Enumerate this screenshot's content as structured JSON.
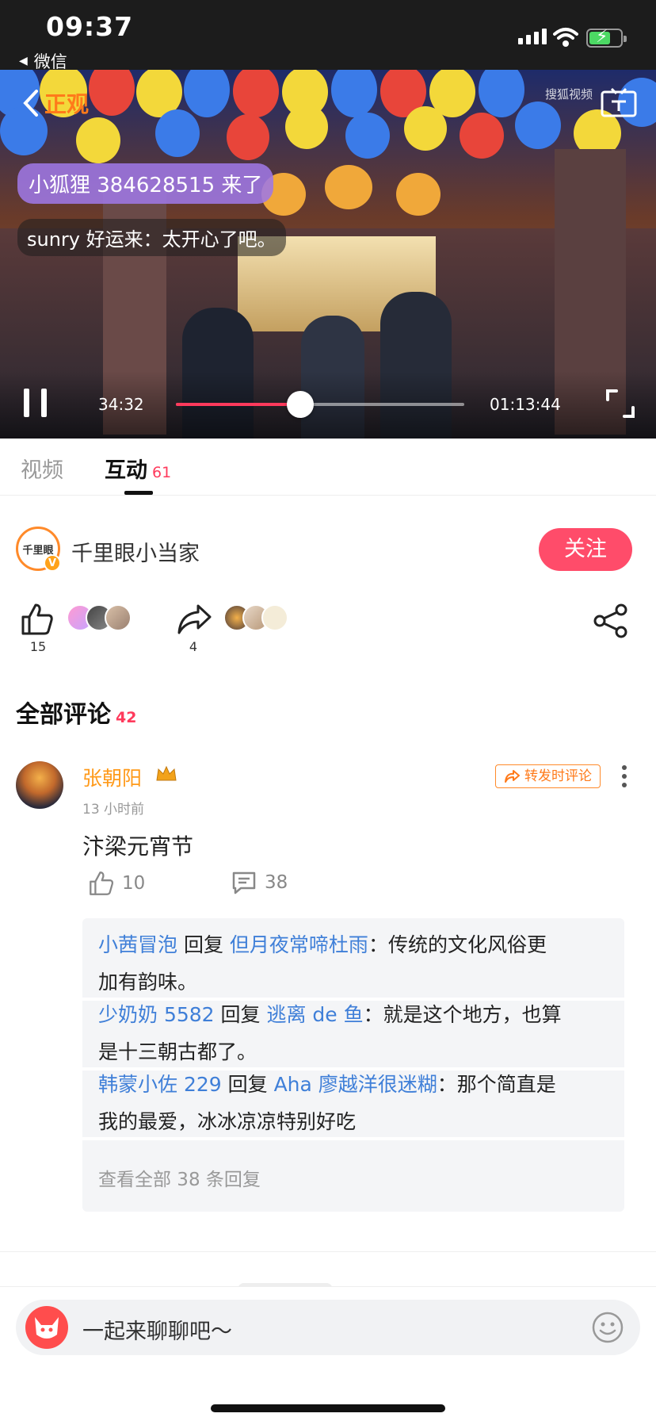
{
  "status_bar": {
    "time": "09:37",
    "back_app": "微信"
  },
  "player": {
    "back_label": "正观",
    "watermark": "搜狐视频",
    "join_notice": "小狐狸 384628515 来了",
    "danmaku": "sunry 好运来：太开心了吧。",
    "current_time": "34:32",
    "total_time": "01:13:44",
    "progress": 0.43
  },
  "tabs": [
    {
      "label": "视频"
    },
    {
      "label": "互动",
      "count": "61"
    }
  ],
  "author": {
    "avatar_text": "千里眼",
    "name": "千里眼小当家",
    "follow_label": "关注"
  },
  "actions": {
    "likes": "15",
    "shares": "4"
  },
  "comments_section": {
    "title": "全部评论",
    "count": "42"
  },
  "comment": {
    "user": "张朝阳",
    "time": "13 小时前",
    "repost_label": "转发时评论",
    "text": "汴梁元宵节",
    "likes": "10",
    "replies_count": "38",
    "replies": [
      {
        "user": "小茜冒泡",
        "verb": " 回复 ",
        "target": "但月夜常啼杜雨",
        "line1": "：传统的文化风俗更",
        "line2": "加有韵味。"
      },
      {
        "user": "少奶奶 5582",
        "verb": " 回复 ",
        "target": "逃离 de 鱼",
        "line1": "：就是这个地方，也算",
        "line2": "是十三朝古都了。"
      },
      {
        "user": "韩蒙小佐 229",
        "verb": " 回复 ",
        "target": "Aha 廖越洋很迷糊",
        "line1": "：那个简直是",
        "line2": "我的最爱，冰冰凉凉特别好吃"
      }
    ],
    "view_all": "查看全部 38 条回复"
  },
  "input": {
    "placeholder": "一起来聊聊吧～"
  },
  "colors": {
    "accent": "#ff4c6a",
    "link": "#3f7fd8",
    "username": "#ff9a1a"
  }
}
